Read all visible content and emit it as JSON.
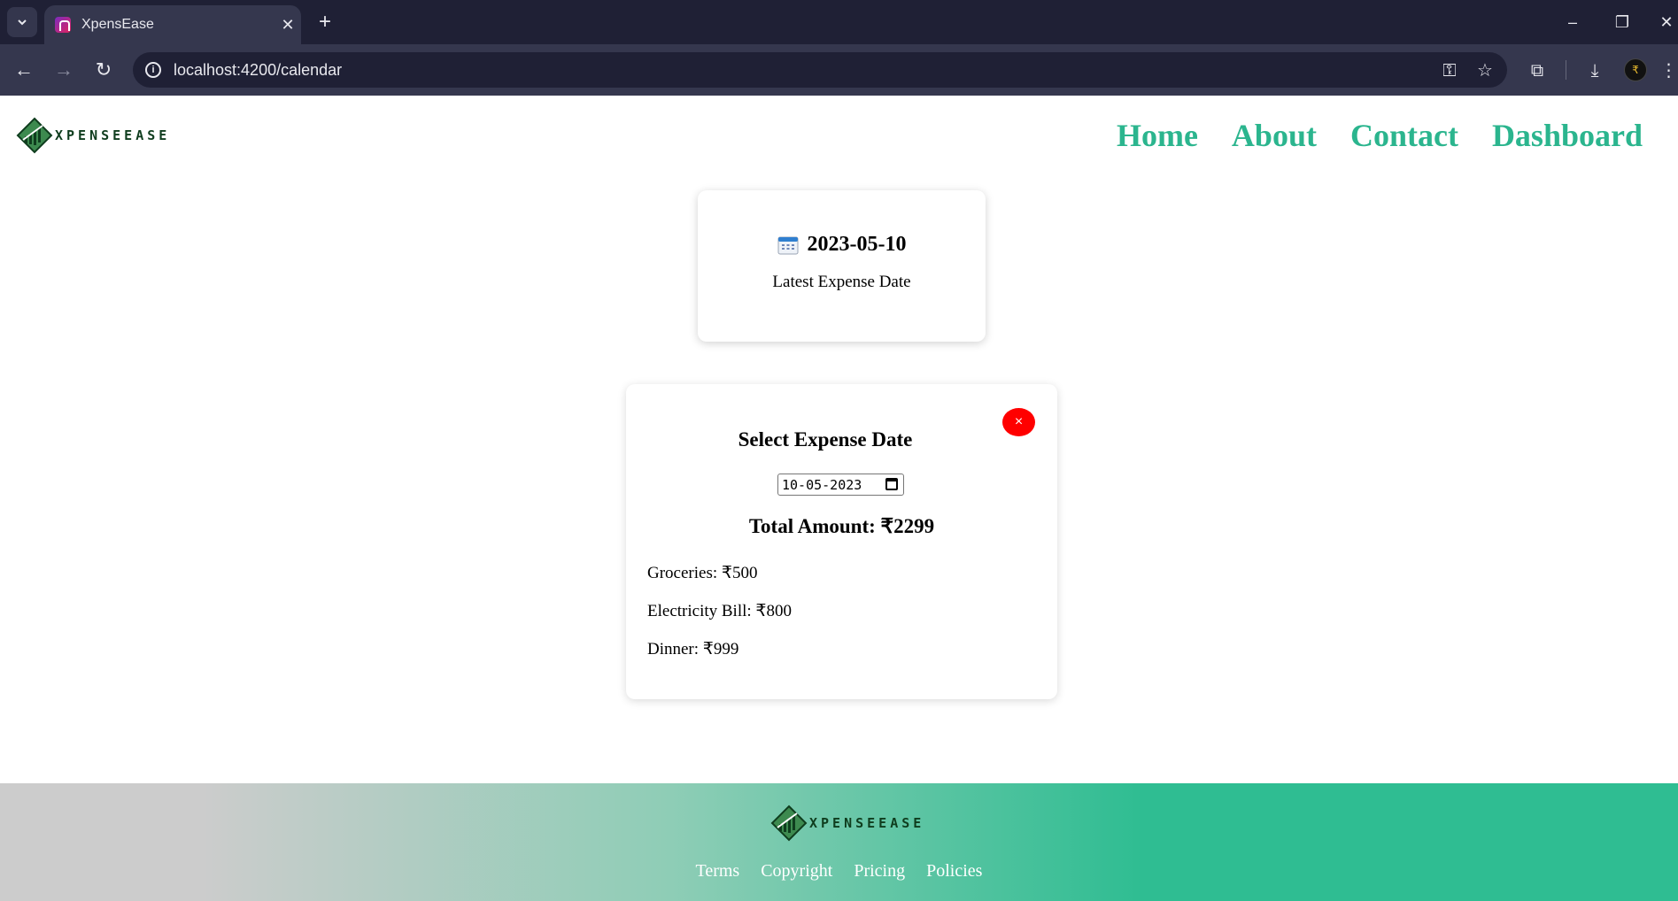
{
  "browser": {
    "tab_title": "XpensEase",
    "url": "localhost:4200/calendar",
    "profile_initial": "₹"
  },
  "brand": {
    "logo_text": "XPENSEEASE",
    "accent_color": "#2bb58e",
    "logo_dark_color": "#0f3d1e"
  },
  "nav": {
    "items": [
      {
        "label": "Home"
      },
      {
        "label": "About"
      },
      {
        "label": "Contact"
      },
      {
        "label": "Dashboard"
      }
    ]
  },
  "latest": {
    "date": "2023-05-10",
    "caption": "Latest Expense Date"
  },
  "expense_panel": {
    "title": "Select Expense Date",
    "close_label": "×",
    "date_input_value": "10-05-2023",
    "total_text": "Total Amount: ₹2299",
    "items": [
      {
        "text": "Groceries: ₹500"
      },
      {
        "text": "Electricity Bill: ₹800"
      },
      {
        "text": "Dinner: ₹999"
      }
    ],
    "close_color": "#ff0000"
  },
  "footer": {
    "logo_text": "XPENSEEASE",
    "links": [
      {
        "label": "Terms"
      },
      {
        "label": "Copyright"
      },
      {
        "label": "Pricing"
      },
      {
        "label": "Policies"
      }
    ]
  }
}
